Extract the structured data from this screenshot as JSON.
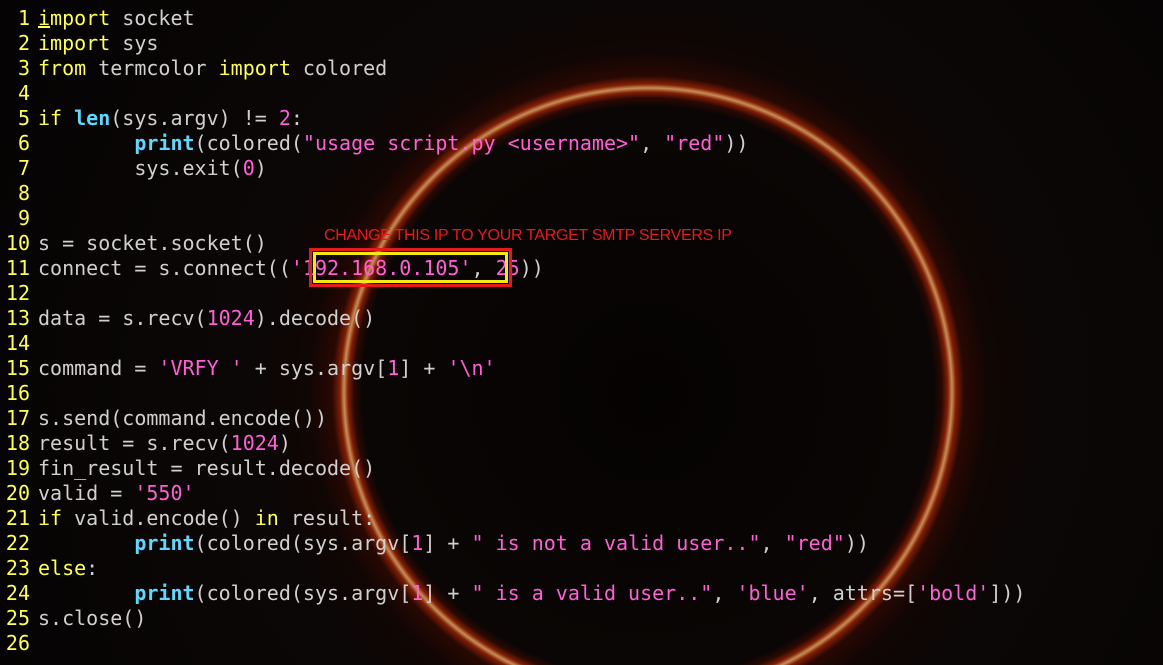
{
  "annotation": {
    "text": "CHANGE THIS IP TO YOUR TARGET SMTP SERVERS IP",
    "color": "#e31b1b",
    "highlight_inner_color": "#f5ea10"
  },
  "colors": {
    "line_number": "#ffff55",
    "keyword": "#ffff55",
    "function": "#5fd7ff",
    "string": "#ff5fd7",
    "plain": "#d0d0d0",
    "background": "#000000"
  },
  "lines": [
    {
      "n": "1",
      "tokens": [
        [
          "kw ul",
          "i"
        ],
        [
          "kw",
          "mport"
        ],
        [
          "code",
          " socket"
        ]
      ]
    },
    {
      "n": "2",
      "tokens": [
        [
          "kw",
          "import"
        ],
        [
          "code",
          " sys"
        ]
      ]
    },
    {
      "n": "3",
      "tokens": [
        [
          "kw",
          "from"
        ],
        [
          "code",
          " termcolor "
        ],
        [
          "kw",
          "import"
        ],
        [
          "code",
          " colored"
        ]
      ]
    },
    {
      "n": "4",
      "tokens": []
    },
    {
      "n": "5",
      "tokens": [
        [
          "kw",
          "if"
        ],
        [
          "code",
          " "
        ],
        [
          "bfn",
          "len"
        ],
        [
          "code",
          "(sys.argv) != "
        ],
        [
          "num",
          "2"
        ],
        [
          "code",
          ":"
        ]
      ]
    },
    {
      "n": "6",
      "tokens": [
        [
          "code",
          "        "
        ],
        [
          "bfn",
          "print"
        ],
        [
          "code",
          "(colored("
        ],
        [
          "str",
          "\"usage script.py <username>\""
        ],
        [
          "code",
          ", "
        ],
        [
          "str",
          "\"red\""
        ],
        [
          "code",
          "))"
        ]
      ]
    },
    {
      "n": "7",
      "tokens": [
        [
          "code",
          "        sys.exit("
        ],
        [
          "num",
          "0"
        ],
        [
          "code",
          ")"
        ]
      ]
    },
    {
      "n": "8",
      "tokens": []
    },
    {
      "n": "9",
      "tokens": []
    },
    {
      "n": "10",
      "tokens": [
        [
          "code",
          "s = socket.socket()"
        ]
      ]
    },
    {
      "n": "11",
      "tokens": [
        [
          "code",
          "connect = s.connect(("
        ],
        [
          "str",
          "'192.168.0.105'"
        ],
        [
          "code",
          ", "
        ],
        [
          "num",
          "25"
        ],
        [
          "code",
          "))"
        ]
      ]
    },
    {
      "n": "12",
      "tokens": []
    },
    {
      "n": "13",
      "tokens": [
        [
          "code",
          "data = s.recv("
        ],
        [
          "num",
          "1024"
        ],
        [
          "code",
          ").decode()"
        ]
      ]
    },
    {
      "n": "14",
      "tokens": []
    },
    {
      "n": "15",
      "tokens": [
        [
          "code",
          "command = "
        ],
        [
          "str",
          "'VRFY '"
        ],
        [
          "code",
          " + sys.argv["
        ],
        [
          "num",
          "1"
        ],
        [
          "code",
          "] + "
        ],
        [
          "str",
          "'\\n'"
        ]
      ]
    },
    {
      "n": "16",
      "tokens": []
    },
    {
      "n": "17",
      "tokens": [
        [
          "code",
          "s.send(command.encode())"
        ]
      ]
    },
    {
      "n": "18",
      "tokens": [
        [
          "code",
          "result = s.recv("
        ],
        [
          "num",
          "1024"
        ],
        [
          "code",
          ")"
        ]
      ]
    },
    {
      "n": "19",
      "tokens": [
        [
          "code",
          "fin_result = result.decode()"
        ]
      ]
    },
    {
      "n": "20",
      "tokens": [
        [
          "code",
          "valid = "
        ],
        [
          "str",
          "'550'"
        ]
      ]
    },
    {
      "n": "21",
      "tokens": [
        [
          "kw",
          "if"
        ],
        [
          "code",
          " valid.encode() "
        ],
        [
          "kw",
          "in"
        ],
        [
          "code",
          " result:"
        ]
      ]
    },
    {
      "n": "22",
      "tokens": [
        [
          "code",
          "        "
        ],
        [
          "bfn",
          "print"
        ],
        [
          "code",
          "(colored(sys.argv["
        ],
        [
          "num",
          "1"
        ],
        [
          "code",
          "] + "
        ],
        [
          "str",
          "\" is not a valid user..\""
        ],
        [
          "code",
          ", "
        ],
        [
          "str",
          "\"red\""
        ],
        [
          "code",
          "))"
        ]
      ]
    },
    {
      "n": "23",
      "tokens": [
        [
          "kw",
          "else"
        ],
        [
          "code",
          ":"
        ]
      ]
    },
    {
      "n": "24",
      "tokens": [
        [
          "code",
          "        "
        ],
        [
          "bfn",
          "print"
        ],
        [
          "code",
          "(colored(sys.argv["
        ],
        [
          "num",
          "1"
        ],
        [
          "code",
          "] + "
        ],
        [
          "str",
          "\" is a valid user..\""
        ],
        [
          "code",
          ", "
        ],
        [
          "str",
          "'blue'"
        ],
        [
          "code",
          ", attrs=["
        ],
        [
          "str",
          "'bold'"
        ],
        [
          "code",
          "]))"
        ]
      ]
    },
    {
      "n": "25",
      "tokens": [
        [
          "code",
          "s.close()"
        ]
      ]
    },
    {
      "n": "26",
      "tokens": []
    }
  ]
}
